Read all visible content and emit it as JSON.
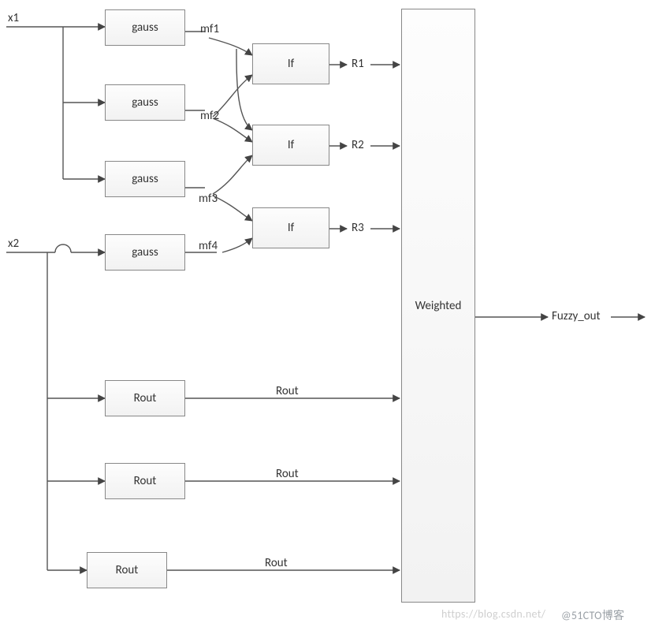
{
  "inputs": {
    "x1": "x1",
    "x2": "x2"
  },
  "gauss": {
    "g1": "gauss",
    "g2": "gauss",
    "g3": "gauss",
    "g4": "gauss"
  },
  "mf": {
    "mf1": "mf1",
    "mf2": "mf2",
    "mf3": "mf3",
    "mf4": "mf4"
  },
  "if": {
    "if1": "If",
    "if2": "If",
    "if3": "If"
  },
  "r": {
    "r1": "R1",
    "r2": "R2",
    "r3": "R3"
  },
  "rout_box": {
    "b1": "Rout",
    "b2": "Rout",
    "b3": "Rout"
  },
  "rout_label": {
    "l1": "Rout",
    "l2": "Rout",
    "l3": "Rout"
  },
  "weighted": "Weighted",
  "output": "Fuzzy_out",
  "watermark": {
    "left": "https://blog.csdn.net/",
    "right": "@51CTO博客"
  }
}
